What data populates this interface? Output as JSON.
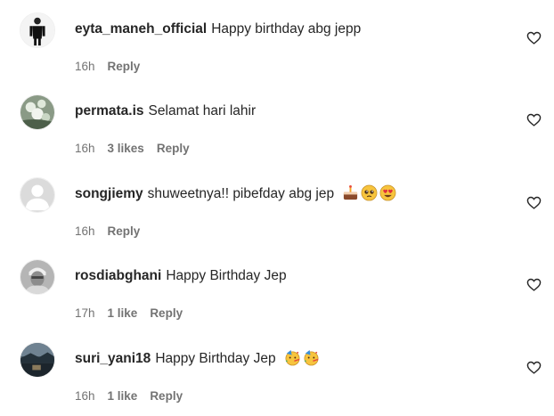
{
  "comments": [
    {
      "username": "eyta_maneh_official",
      "text": "Happy birthday abg jepp",
      "emojis": [],
      "time": "16h",
      "likes": "",
      "reply": "Reply",
      "avatar_icon": "person-standing-avatar"
    },
    {
      "username": "permata.is",
      "text": "Selamat hari lahir",
      "emojis": [],
      "time": "16h",
      "likes": "3 likes",
      "reply": "Reply",
      "avatar_icon": "flower-photo-avatar"
    },
    {
      "username": "songjiemy",
      "text": "shuweetnya!! pibefday abg jep",
      "emojis": [
        "birthday-cake-emoji",
        "pleading-face-emoji",
        "heart-eyes-emoji"
      ],
      "time": "16h",
      "likes": "",
      "reply": "Reply",
      "avatar_icon": "default-user-avatar"
    },
    {
      "username": "rosdiabghani",
      "text": "Happy Birthday Jep",
      "emojis": [],
      "time": "17h",
      "likes": "1 like",
      "reply": "Reply",
      "avatar_icon": "grayscale-face-avatar"
    },
    {
      "username": "suri_yani18",
      "text": "Happy Birthday Jep",
      "emojis": [
        "partying-face-emoji",
        "partying-face-emoji"
      ],
      "time": "16h",
      "likes": "1 like",
      "reply": "Reply",
      "avatar_icon": "landscape-photo-avatar"
    }
  ],
  "like_icon": "heart-outline-icon",
  "colors": {
    "text": "#262626",
    "meta": "#737373",
    "background": "#ffffff"
  }
}
